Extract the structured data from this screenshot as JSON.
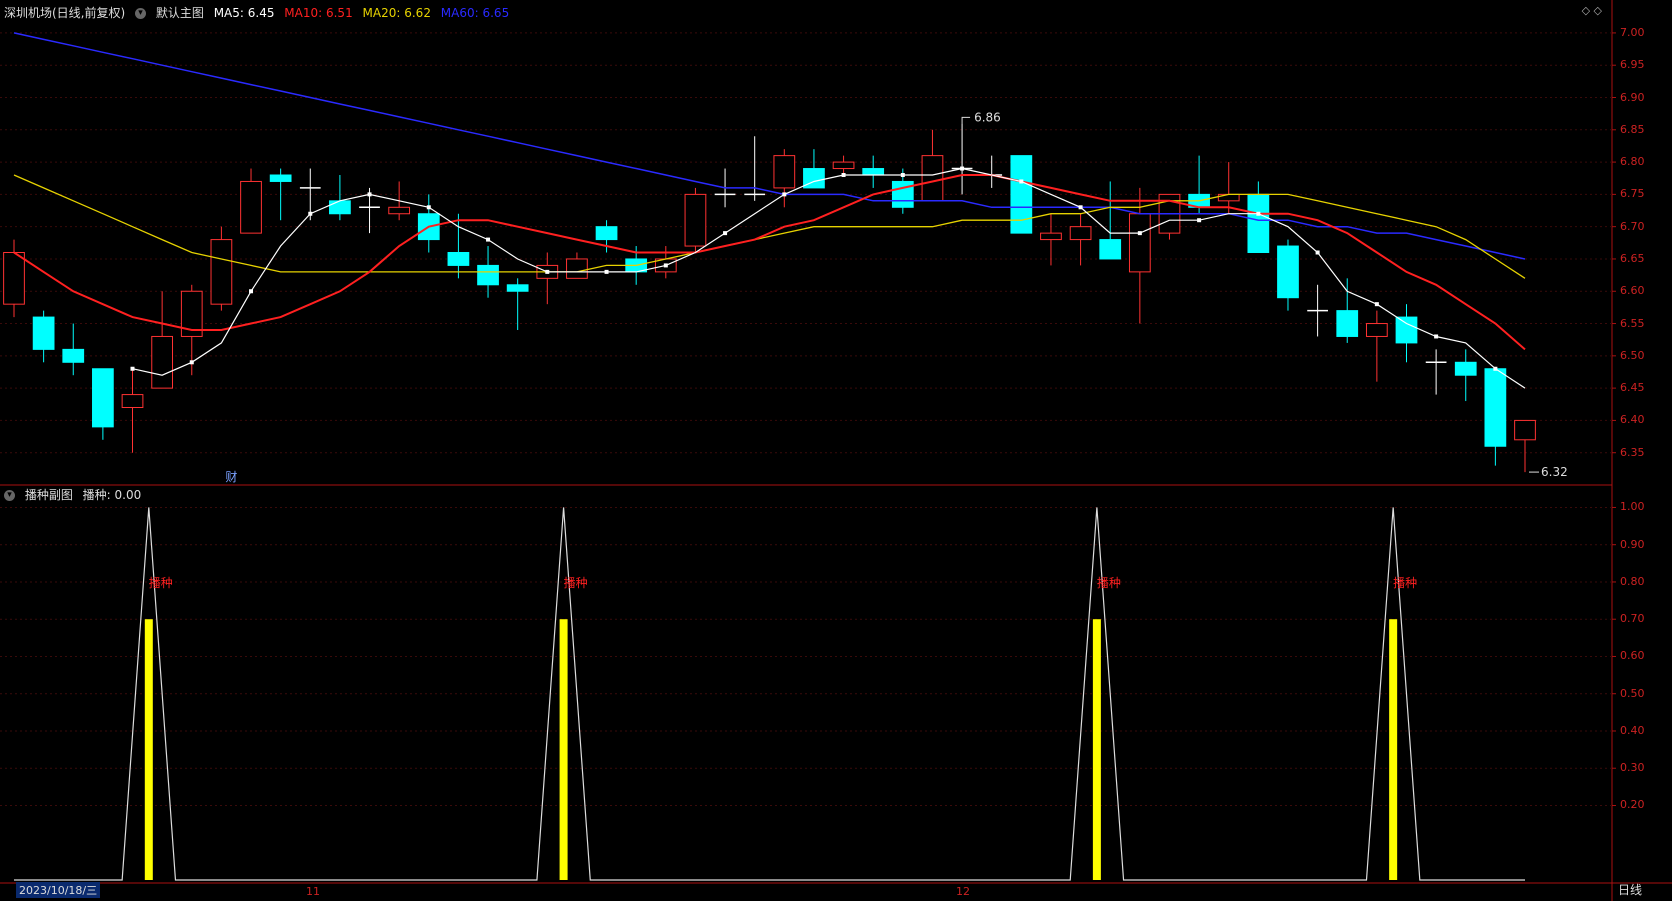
{
  "header_main": {
    "title": "深圳机场(日线,前复权)",
    "menu_icon": "chevron-down-icon",
    "indicator_name": "默认主图",
    "ma5": "MA5: 6.45",
    "ma10": "MA10: 6.51",
    "ma20": "MA20: 6.62",
    "ma60": "MA60: 6.65"
  },
  "header_sub": {
    "indicator_name": "播种副图",
    "value_text": "播种: 0.00"
  },
  "colors": {
    "up": "#ff3232",
    "down": "#00ffff",
    "ma5": "#ffffff",
    "ma10": "#ff2020",
    "ma20": "#e6d200",
    "ma60": "#2a2aff",
    "axis": "#aa1111",
    "signal_bar": "#ffff00",
    "signal_text": "#ff2020"
  },
  "price_axis_labels": [
    "7.00",
    "6.95",
    "6.90",
    "6.85",
    "6.80",
    "6.75",
    "6.70",
    "6.65",
    "6.60",
    "6.55",
    "6.50",
    "6.45",
    "6.40",
    "6.35"
  ],
  "sub_axis_labels": [
    "1.00",
    "0.90",
    "0.80",
    "0.70",
    "0.60",
    "0.50",
    "0.40",
    "0.30",
    "0.20"
  ],
  "date_labels": {
    "start": "2023/10/18/三",
    "nov": "11",
    "dec": "12"
  },
  "annotations": {
    "high": "6.86",
    "low": "6.32",
    "fin_marker": "财"
  },
  "signal_label": "播种",
  "period_button": "日线",
  "top_icons": "◇ ◇",
  "chart_data": {
    "type": "candlestick",
    "ohlc": [
      [
        6.58,
        6.68,
        6.56,
        6.66
      ],
      [
        6.56,
        6.57,
        6.49,
        6.51
      ],
      [
        6.51,
        6.55,
        6.47,
        6.49
      ],
      [
        6.48,
        6.48,
        6.37,
        6.39
      ],
      [
        6.42,
        6.48,
        6.35,
        6.44
      ],
      [
        6.45,
        6.6,
        6.45,
        6.53
      ],
      [
        6.53,
        6.61,
        6.47,
        6.6
      ],
      [
        6.58,
        6.7,
        6.57,
        6.68
      ],
      [
        6.69,
        6.79,
        6.69,
        6.77
      ],
      [
        6.78,
        6.79,
        6.71,
        6.77
      ],
      [
        6.76,
        6.79,
        6.71,
        6.76
      ],
      [
        6.74,
        6.78,
        6.71,
        6.72
      ],
      [
        6.73,
        6.76,
        6.69,
        6.73
      ],
      [
        6.72,
        6.77,
        6.71,
        6.73
      ],
      [
        6.72,
        6.75,
        6.66,
        6.68
      ],
      [
        6.66,
        6.72,
        6.62,
        6.64
      ],
      [
        6.64,
        6.67,
        6.59,
        6.61
      ],
      [
        6.61,
        6.62,
        6.54,
        6.6
      ],
      [
        6.62,
        6.66,
        6.58,
        6.64
      ],
      [
        6.62,
        6.66,
        6.62,
        6.65
      ],
      [
        6.7,
        6.71,
        6.66,
        6.68
      ],
      [
        6.65,
        6.67,
        6.61,
        6.63
      ],
      [
        6.63,
        6.67,
        6.62,
        6.65
      ],
      [
        6.67,
        6.76,
        6.66,
        6.75
      ],
      [
        6.75,
        6.79,
        6.73,
        6.75
      ],
      [
        6.75,
        6.84,
        6.74,
        6.75
      ],
      [
        6.76,
        6.82,
        6.73,
        6.81
      ],
      [
        6.79,
        6.82,
        6.76,
        6.76
      ],
      [
        6.79,
        6.81,
        6.78,
        6.8
      ],
      [
        6.79,
        6.81,
        6.76,
        6.78
      ],
      [
        6.77,
        6.79,
        6.72,
        6.73
      ],
      [
        6.74,
        6.85,
        6.74,
        6.81
      ],
      [
        6.79,
        6.86,
        6.75,
        6.79
      ],
      [
        6.78,
        6.81,
        6.76,
        6.78
      ],
      [
        6.81,
        6.81,
        6.69,
        6.69
      ],
      [
        6.68,
        6.72,
        6.64,
        6.69
      ],
      [
        6.68,
        6.72,
        6.64,
        6.7
      ],
      [
        6.68,
        6.77,
        6.65,
        6.65
      ],
      [
        6.63,
        6.76,
        6.55,
        6.72
      ],
      [
        6.69,
        6.75,
        6.68,
        6.75
      ],
      [
        6.75,
        6.81,
        6.72,
        6.73
      ],
      [
        6.74,
        6.8,
        6.72,
        6.75
      ],
      [
        6.75,
        6.77,
        6.66,
        6.66
      ],
      [
        6.67,
        6.68,
        6.57,
        6.59
      ],
      [
        6.57,
        6.61,
        6.53,
        6.57
      ],
      [
        6.57,
        6.62,
        6.52,
        6.53
      ],
      [
        6.53,
        6.57,
        6.46,
        6.55
      ],
      [
        6.56,
        6.58,
        6.49,
        6.52
      ],
      [
        6.49,
        6.51,
        6.44,
        6.49
      ],
      [
        6.49,
        6.51,
        6.43,
        6.47
      ],
      [
        6.48,
        6.48,
        6.33,
        6.36
      ],
      [
        6.37,
        6.4,
        6.32,
        6.4
      ]
    ],
    "ma5": [
      null,
      null,
      null,
      null,
      6.48,
      6.47,
      6.49,
      6.52,
      6.6,
      6.67,
      6.72,
      6.74,
      6.75,
      6.74,
      6.73,
      6.7,
      6.68,
      6.65,
      6.63,
      6.63,
      6.63,
      6.63,
      6.64,
      6.66,
      6.69,
      6.72,
      6.75,
      6.77,
      6.78,
      6.78,
      6.78,
      6.78,
      6.79,
      6.78,
      6.77,
      6.75,
      6.73,
      6.69,
      6.69,
      6.71,
      6.71,
      6.72,
      6.72,
      6.7,
      6.66,
      6.6,
      6.58,
      6.55,
      6.53,
      6.52,
      6.48,
      6.45
    ],
    "ma10": [
      6.66,
      6.63,
      6.6,
      6.58,
      6.56,
      6.55,
      6.54,
      6.54,
      6.55,
      6.56,
      6.58,
      6.6,
      6.63,
      6.67,
      6.7,
      6.71,
      6.71,
      6.7,
      6.69,
      6.68,
      6.67,
      6.66,
      6.66,
      6.66,
      6.67,
      6.68,
      6.7,
      6.71,
      6.73,
      6.75,
      6.76,
      6.77,
      6.78,
      6.78,
      6.77,
      6.76,
      6.75,
      6.74,
      6.74,
      6.74,
      6.73,
      6.73,
      6.72,
      6.72,
      6.71,
      6.69,
      6.66,
      6.63,
      6.61,
      6.58,
      6.55,
      6.51
    ],
    "ma20": [
      6.78,
      6.76,
      6.74,
      6.72,
      6.7,
      6.68,
      6.66,
      6.65,
      6.64,
      6.63,
      6.63,
      6.63,
      6.63,
      6.63,
      6.63,
      6.63,
      6.63,
      6.63,
      6.63,
      6.63,
      6.64,
      6.64,
      6.65,
      6.66,
      6.67,
      6.68,
      6.69,
      6.7,
      6.7,
      6.7,
      6.7,
      6.7,
      6.71,
      6.71,
      6.71,
      6.72,
      6.72,
      6.73,
      6.73,
      6.74,
      6.74,
      6.75,
      6.75,
      6.75,
      6.74,
      6.73,
      6.72,
      6.71,
      6.7,
      6.68,
      6.65,
      6.62
    ],
    "ma60": [
      7.0,
      6.99,
      6.98,
      6.97,
      6.96,
      6.95,
      6.94,
      6.93,
      6.92,
      6.91,
      6.9,
      6.89,
      6.88,
      6.87,
      6.86,
      6.85,
      6.84,
      6.83,
      6.82,
      6.81,
      6.8,
      6.79,
      6.78,
      6.77,
      6.76,
      6.76,
      6.75,
      6.75,
      6.75,
      6.74,
      6.74,
      6.74,
      6.74,
      6.73,
      6.73,
      6.73,
      6.73,
      6.73,
      6.72,
      6.72,
      6.72,
      6.72,
      6.71,
      6.71,
      6.7,
      6.7,
      6.69,
      6.69,
      6.68,
      6.67,
      6.66,
      6.65
    ],
    "signal_index": [
      4,
      18,
      36,
      46
    ],
    "signal_peak": 1.0,
    "signal_bar": 0.7,
    "price_range": [
      6.3,
      7.02
    ],
    "sub_range": [
      0.0,
      1.02
    ]
  }
}
